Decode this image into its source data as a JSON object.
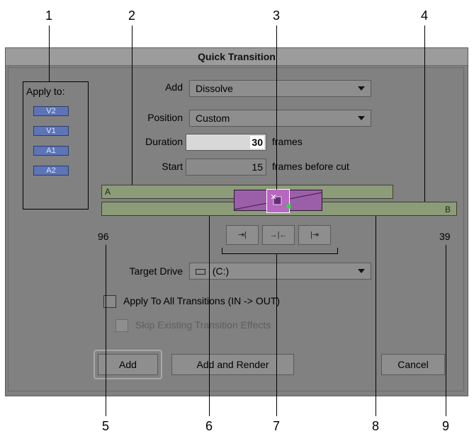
{
  "callouts": [
    "1",
    "2",
    "3",
    "4",
    "5",
    "6",
    "7",
    "8",
    "9"
  ],
  "dialog": {
    "title": "Quick Transition",
    "apply_to": {
      "label": "Apply to:",
      "tracks": [
        "V2",
        "V1",
        "A1",
        "A2"
      ]
    },
    "add": {
      "label": "Add",
      "value": "Dissolve"
    },
    "position": {
      "label": "Position",
      "value": "Custom"
    },
    "duration": {
      "label": "Duration",
      "value": "30",
      "unit": "frames"
    },
    "start": {
      "label": "Start",
      "value": "15",
      "unit": "frames before cut"
    },
    "timeline": {
      "track_a": "A",
      "track_b": "B",
      "left_count": "96",
      "right_count": "39"
    },
    "nudge_buttons": [
      "⇥|",
      "→|←",
      "|⇥"
    ],
    "target_drive": {
      "label": "Target Drive",
      "value": "(C:)"
    },
    "apply_all_label": "Apply To All Transitions (IN -> OUT)",
    "skip_label": "Skip Existing Transition Effects",
    "buttons": {
      "add": "Add",
      "add_render": "Add and Render",
      "cancel": "Cancel"
    }
  }
}
